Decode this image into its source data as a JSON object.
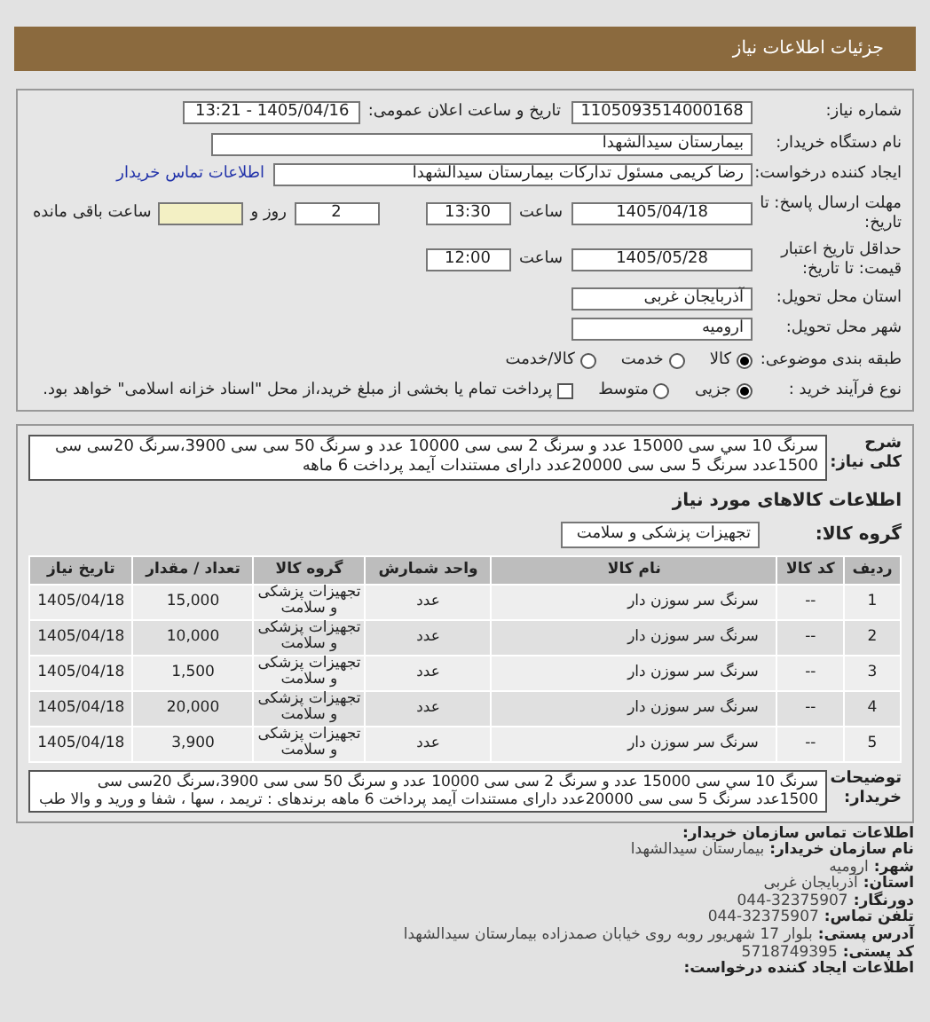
{
  "header": {
    "title": "جزئیات اطلاعات نیاز"
  },
  "need_number": {
    "label": "شماره نیاز:",
    "value": "1105093514000168"
  },
  "announce": {
    "label": "تاریخ و ساعت اعلان عمومی:",
    "value": "1405/04/16 - 13:21"
  },
  "buyer": {
    "label": "نام دستگاه خریدار:",
    "value": "بیمارستان سیدالشهدا"
  },
  "creator": {
    "label": "ایجاد کننده درخواست:",
    "value": "رضا کریمی مسئول تدارکات بیمارستان سیدالشهدا",
    "link": "اطلاعات تماس خریدار"
  },
  "deadline": {
    "label": "مهلت ارسال پاسخ: تا تاریخ:",
    "date": "1405/04/18",
    "time_label": "ساعت",
    "time": "13:30",
    "days": "2",
    "days_label": "روز و",
    "remaining_label": "ساعت باقی مانده"
  },
  "validity": {
    "label": "حداقل تاریخ اعتبار قیمت: تا تاریخ:",
    "date": "1405/05/28",
    "time_label": "ساعت",
    "time": "12:00"
  },
  "province": {
    "label": "استان محل تحویل:",
    "value": "آذربایجان غربی"
  },
  "city": {
    "label": "شهر محل تحویل:",
    "value": "ارومیه"
  },
  "category": {
    "label": "طبقه بندی موضوعی:",
    "options": [
      {
        "label": "کالا",
        "selected": true
      },
      {
        "label": "خدمت",
        "selected": false
      },
      {
        "label": "کالا/خدمت",
        "selected": false
      }
    ]
  },
  "process": {
    "label": "نوع فرآیند خرید :",
    "options": [
      {
        "label": "جزیی",
        "selected": true
      },
      {
        "label": "متوسط",
        "selected": false
      }
    ],
    "treasury": {
      "label": "پرداخت تمام یا بخشی از مبلغ خرید،از محل \"اسناد خزانه اسلامی\" خواهد بود.",
      "checked": false
    }
  },
  "description": {
    "label": "شرح کلی نیاز:",
    "text": "سرنگ 10 سي سی 15000 عدد و سرنگ 2 سی سی 10000 عدد و سرنگ 50 سی سی 3900،سرنگ 20سی سی 1500عدد سرنگ 5 سی سی 20000عدد دارای مستندات آیمد پرداخت 6 ماهه"
  },
  "goods_heading": "اطلاعات کالاهای مورد نیاز",
  "goods_group": {
    "label": "گروه کالا:",
    "value": "تجهیزات پزشکی و سلامت"
  },
  "table": {
    "columns": [
      "ردیف",
      "کد کالا",
      "نام کالا",
      "واحد شمارش",
      "گروه کالا",
      "تعداد / مقدار",
      "تاریخ نیاز"
    ],
    "rows": [
      [
        "1",
        "--",
        "سرنگ سر سوزن دار",
        "عدد",
        "تجهیزات پزشکی و سلامت",
        "15,000",
        "1405/04/18"
      ],
      [
        "2",
        "--",
        "سرنگ سر سوزن دار",
        "عدد",
        "تجهیزات پزشکی و سلامت",
        "10,000",
        "1405/04/18"
      ],
      [
        "3",
        "--",
        "سرنگ سر سوزن دار",
        "عدد",
        "تجهیزات پزشکی و سلامت",
        "1,500",
        "1405/04/18"
      ],
      [
        "4",
        "--",
        "سرنگ سر سوزن دار",
        "عدد",
        "تجهیزات پزشکی و سلامت",
        "20,000",
        "1405/04/18"
      ],
      [
        "5",
        "--",
        "سرنگ سر سوزن دار",
        "عدد",
        "تجهیزات پزشکی و سلامت",
        "3,900",
        "1405/04/18"
      ]
    ]
  },
  "buyer_notes": {
    "label": "توضیحات خریدار:",
    "text": "سرنگ 10 سي سی 15000 عدد و سرنگ 2 سی سی 10000 عدد و سرنگ 50 سی سی 3900،سرنگ 20سی سی 1500عدد سرنگ 5 سی سی 20000عدد دارای مستندات آیمد پرداخت 6 ماهه برندهای : تریمد ، سها ، شفا و ورید و والا طب"
  },
  "contact": {
    "heading": "اطلاعات تماس سازمان خریدار:",
    "items": [
      {
        "label": "نام سازمان خریدار:",
        "value": "بیمارستان سیدالشهدا"
      },
      {
        "label": "شهر:",
        "value": "ارومیه"
      },
      {
        "label": "استان:",
        "value": "آذربایجان غربی"
      },
      {
        "label": "دورنگار:",
        "value": "044-32375907"
      },
      {
        "label": "تلفن تماس:",
        "value": "044-32375907"
      },
      {
        "label": "آدرس پستی:",
        "value": "بلوار 17 شهریور روبه روی خیابان صمدزاده بیمارستان سیدالشهدا"
      },
      {
        "label": "کد پستی:",
        "value": "5718749395"
      }
    ],
    "footer": "اطلاعات ایجاد کننده درخواست:"
  }
}
